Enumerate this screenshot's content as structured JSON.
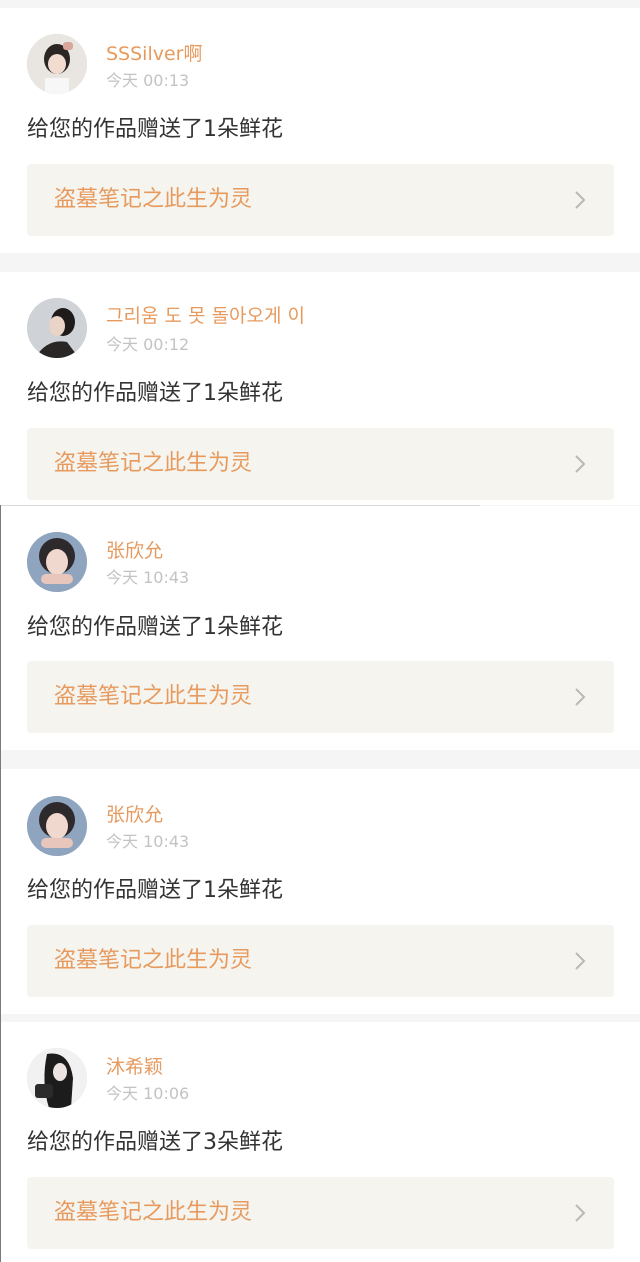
{
  "colors": {
    "accent": "#e79a5e",
    "message_text": "#333333",
    "time_text": "#c3c3c3",
    "link_background": "#f5f4ef",
    "page_background": "#f5f5f5"
  },
  "notifications": [
    {
      "username": "SSSilver啊",
      "time": "今天 00:13",
      "message": "给您的作品赠送了1朵鲜花",
      "work_title": "盗墓笔记之此生为灵",
      "chevron_icon": "chevron-right-icon"
    },
    {
      "username": "그리움 도 못 돌아오게 이",
      "time": "今天 00:12",
      "message": "给您的作品赠送了1朵鲜花",
      "work_title": "盗墓笔记之此生为灵",
      "chevron_icon": "chevron-right-icon"
    },
    {
      "username": "张欣允",
      "time": "今天 10:43",
      "message": "给您的作品赠送了1朵鲜花",
      "work_title": "盗墓笔记之此生为灵",
      "chevron_icon": "chevron-right-icon"
    },
    {
      "username": "张欣允",
      "time": "今天 10:43",
      "message": "给您的作品赠送了1朵鲜花",
      "work_title": "盗墓笔记之此生为灵",
      "chevron_icon": "chevron-right-icon"
    },
    {
      "username": "沐希颖",
      "time": "今天 10:06",
      "message": "给您的作品赠送了3朵鲜花",
      "work_title": "盗墓笔记之此生为灵",
      "chevron_icon": "chevron-right-icon"
    }
  ]
}
